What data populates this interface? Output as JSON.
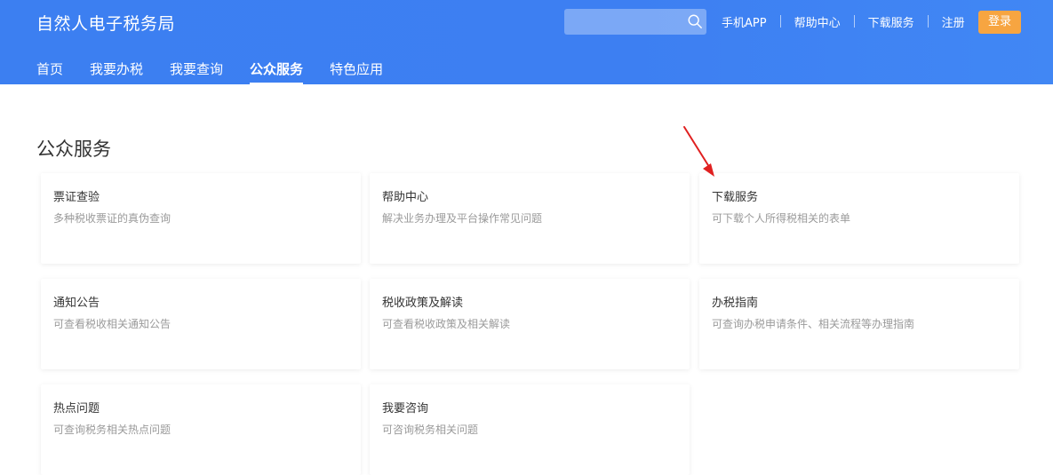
{
  "header": {
    "site_title": "自然人电子税务局",
    "search_placeholder": "",
    "top_links": [
      "手机APP",
      "帮助中心",
      "下载服务",
      "注册"
    ],
    "login_label": "登录"
  },
  "nav": {
    "items": [
      "首页",
      "我要办税",
      "我要查询",
      "公众服务",
      "特色应用"
    ],
    "active": "公众服务"
  },
  "main": {
    "section_title": "公众服务",
    "cards": [
      {
        "title": "票证查验",
        "desc": "多种税收票证的真伪查询"
      },
      {
        "title": "帮助中心",
        "desc": "解决业务办理及平台操作常见问题"
      },
      {
        "title": "下载服务",
        "desc": "可下载个人所得税相关的表单"
      },
      {
        "title": "通知公告",
        "desc": "可查看税收相关通知公告"
      },
      {
        "title": "税收政策及解读",
        "desc": "可查看税收政策及相关解读"
      },
      {
        "title": "办税指南",
        "desc": "可查询办税申请条件、相关流程等办理指南"
      },
      {
        "title": "热点问题",
        "desc": "可查询税务相关热点问题"
      },
      {
        "title": "我要咨询",
        "desc": "可咨询税务相关问题"
      }
    ]
  },
  "colors": {
    "header_blue": "#3c7ff1",
    "login_orange": "#f7a541",
    "annotation_red": "#e02020"
  }
}
